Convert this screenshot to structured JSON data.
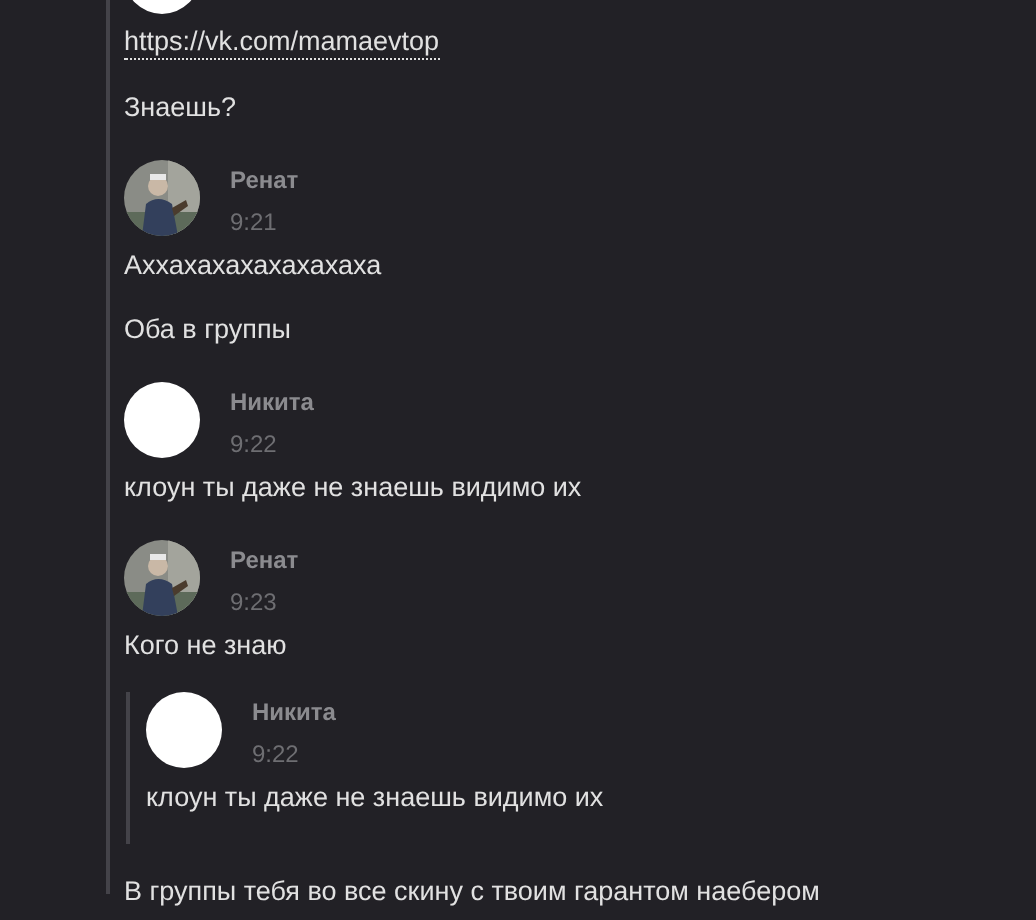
{
  "messages": [
    {
      "kind": "cut_avatar"
    },
    {
      "kind": "link",
      "text": "https://vk.com/mamaevtop"
    },
    {
      "kind": "text",
      "text": "Знаешь?"
    },
    {
      "kind": "author",
      "name": "Ренат",
      "time": "9:21"
    },
    {
      "kind": "text",
      "text": "Аххахахахахахахаха"
    },
    {
      "kind": "text",
      "text": "Оба в группы"
    },
    {
      "kind": "author",
      "avatar": {
        "kind": "blank"
      },
      "name": "Никита",
      "time": "9:22"
    },
    {
      "kind": "text",
      "text": "клоун ты даже не знаешь видимо их"
    },
    {
      "kind": "author",
      "name": "Ренат",
      "time": "9:23"
    },
    {
      "kind": "text",
      "text": "Кого не знаю"
    },
    {
      "kind": "quote",
      "avatar": {
        "kind": "blank"
      },
      "name": "Никита",
      "time": "9:22",
      "text": "клоун ты даже не знаешь видимо их"
    },
    {
      "kind": "text",
      "text": "В группы тебя во все скину с твоим гарантом наебером"
    }
  ]
}
